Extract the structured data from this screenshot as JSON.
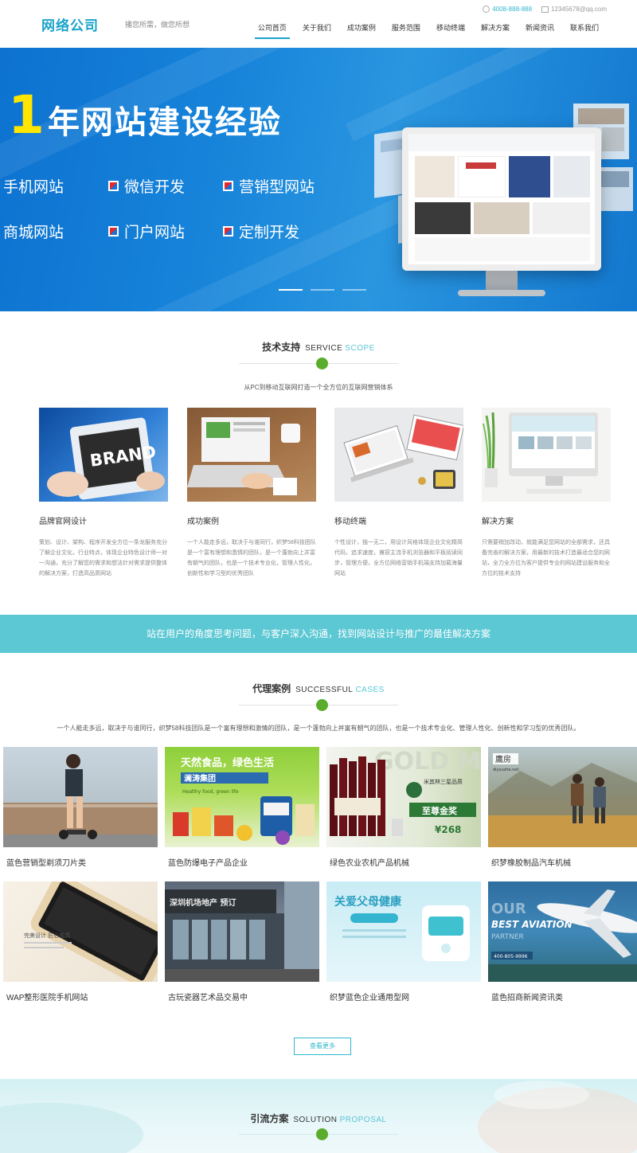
{
  "header": {
    "logo": "网络公司",
    "slogan": "播您所需，做您所想",
    "phone": "4008-888-888",
    "email": "12345678@qq.com",
    "nav": [
      "公司首页",
      "关于我们",
      "成功案例",
      "服务范围",
      "移动终端",
      "解决方案",
      "新闻资讯",
      "联系我们"
    ],
    "active_index": 0
  },
  "banner": {
    "highlight": "1",
    "title": "年网站建设经验",
    "items": [
      "手机网站",
      "微信开发",
      "营销型网站",
      "商城网站",
      "门户网站",
      "定制开发"
    ],
    "slides": 3,
    "active_slide": 1
  },
  "services": {
    "title_cn": "技术支持",
    "title_en1": "SERVICE",
    "title_en2": "SCOPE",
    "subtitle": "从PC到移动互联网打造一个全方位的互联网营销体系",
    "items": [
      {
        "name": "品牌官网设计",
        "desc": "策划、设计、架构、程序开发全方位一条龙服务充分了解企业文化，行业特点，体现企业特色设计师一对一沟通，充分了解您的需求和想法针对需求提供整体的解决方案，打造高品质网站"
      },
      {
        "name": "成功案例",
        "desc": "一个人能走多远，取决于与谁同行，织梦58科技团队是一个富有理想和激情的团队，是一个蓬勃向上并富有朝气的团队，也是一个技术专业化，管理人性化，创新性和学习型的优秀团队"
      },
      {
        "name": "移动终端",
        "desc": "个性设计，独一无二，用设计风格体现企业文化精简代码，追求速度，兼容主流手机浏览器和平板阅读同步，管理方便，全方位网络营销手机端支持加载海量网站"
      },
      {
        "name": "解决方案",
        "desc": "只需要稍加改动，就能满足您网站的全部需求，还具备完善的解决方案，用最新的技术打造最适合您的网站，全力全方位为客户提供专业的网站建设服务和全方位的技术支持"
      }
    ]
  },
  "band": {
    "text": "站在用户的角度思考问题，与客户深入沟通，找到网站设计与推广的最佳解决方案"
  },
  "cases": {
    "title_cn": "代理案例",
    "title_en1": "SUCCESSFUL",
    "title_en2": "CASES",
    "subtitle": "一个人能走多远，取决于与谁同行，织梦58科技团队是一个富有理想和激情的团队，是一个蓬勃向上并富有朝气的团队，也是一个技术专业化、管理人性化、创新性和学习型的优秀团队。",
    "items": [
      {
        "name": "蓝色营销型剃须刀片类"
      },
      {
        "name": "蓝色防爆电子产品企业"
      },
      {
        "name": "绿色农业农机产品机械"
      },
      {
        "name": "织梦橡胶制品汽车机械"
      },
      {
        "name": "WAP整形医院手机网站"
      },
      {
        "name": "古玩瓷器艺术品交易中"
      },
      {
        "name": "织梦蓝色企业通用型网"
      },
      {
        "name": "蓝色招商新闻资讯类"
      }
    ],
    "more_label": "查看更多"
  },
  "case_image_text": {
    "food_heading": "天然食品，绿色生活",
    "food_brand": "澜涛集团",
    "food_tagline": "Healthy food, green life",
    "gold_bg": "GOLD M",
    "award_brand": "米其林三星品质",
    "award_title": "至尊金奖",
    "award_price": "¥268",
    "farm_logo": "鷹房",
    "farm_url": "diyouzhe.net",
    "phone_slogan": "完美设计 匠心独具",
    "building_sign": "深圳机场地产 预订",
    "care_title": "关爱父母健康",
    "aviation_big": "OUR",
    "aviation_text": "BEST AVIATION",
    "aviation_small": "PARTNER",
    "aviation_phone": "400-805-9996"
  },
  "solution": {
    "title_cn": "引流方案",
    "title_en1": "SOLUTION",
    "title_en2": "PROPOSAL"
  },
  "colors": {
    "accent": "#1aa3c9",
    "teal_band": "#5cc8d4",
    "green_dot": "#5aac2c",
    "banner_blue": "#1784da",
    "banner_yellow": "#ffe600"
  }
}
